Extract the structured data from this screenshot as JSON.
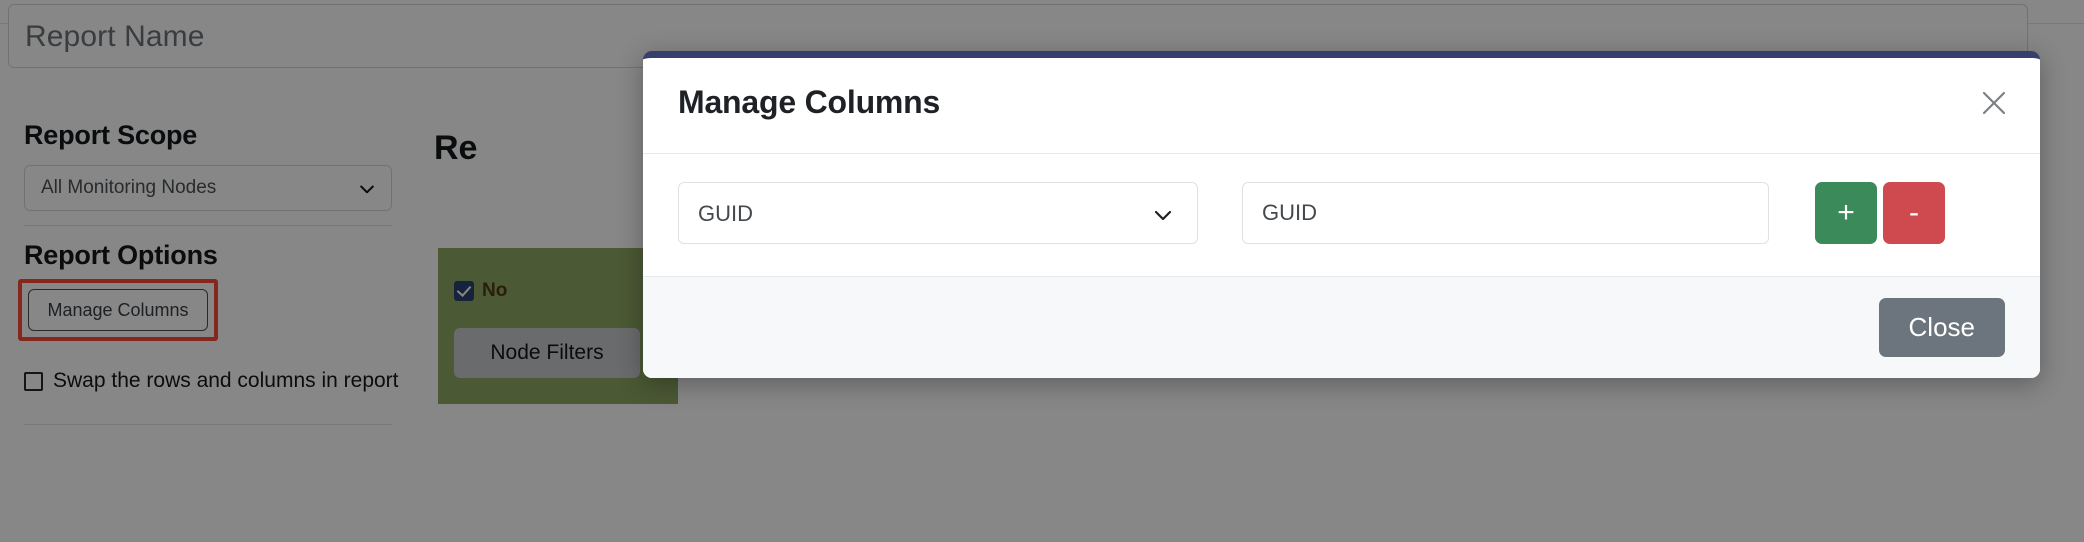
{
  "page": {
    "report_name_placeholder": "Report Name",
    "report_scope_title": "Report Scope",
    "report_scope_value": "All Monitoring Nodes",
    "report_options_title": "Report Options",
    "manage_columns_label": "Manage Columns",
    "swap_label": "Swap the rows and columns in report",
    "preview_title": "Re",
    "node_checkbox_label": "No",
    "node_filters_label": "Node Filters",
    "highlight_color": "#fb4a38",
    "grid_green": "#8fa864"
  },
  "modal": {
    "title": "Manage Columns",
    "close_icon": "close-icon",
    "chevron_icon": "chevron-down-icon",
    "column_select_value": "GUID",
    "column_input_value": "GUID",
    "column_input_placeholder": "GUID",
    "add_label": "+",
    "remove_label": "-",
    "add_color": "#3a8a5a",
    "remove_color": "#ce4a4f",
    "close_label": "Close",
    "close_color": "#6c757d",
    "accent_bar_color": "#36406a"
  }
}
